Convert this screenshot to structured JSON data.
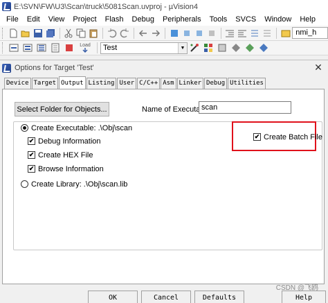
{
  "window": {
    "title": "E:\\SVN\\FW\\U3\\Scan\\truck\\5081Scan.uvproj - µVision4"
  },
  "menu": [
    "File",
    "Edit",
    "View",
    "Project",
    "Flash",
    "Debug",
    "Peripherals",
    "Tools",
    "SVCS",
    "Window",
    "Help"
  ],
  "toolbar": {
    "function_field": "nmi_h",
    "load_label": "Load",
    "target_select": "Test"
  },
  "dialog": {
    "title": "Options for Target 'Test'",
    "tabs": [
      "Device",
      "Target",
      "Output",
      "Listing",
      "User",
      "C/C++",
      "Asm",
      "Linker",
      "Debug",
      "Utilities"
    ],
    "active_tab": "Output",
    "select_folder_button": "Select Folder for Objects...",
    "name_of_executable_label": "Name of Executable:",
    "name_of_executable_value": "scan",
    "create_executable_label": "Create Executable:  .\\Obj\\scan",
    "options": [
      {
        "label": "Debug Information",
        "checked": true
      },
      {
        "label": "Create HEX File",
        "checked": true
      },
      {
        "label": "Browse Information",
        "checked": true
      }
    ],
    "create_batch_file": {
      "label": "Create Batch File",
      "checked": true
    },
    "create_library_label": "Create Library:  .\\Obj\\scan.lib",
    "buttons": {
      "ok": "OK",
      "cancel": "Cancel",
      "defaults": "Defaults",
      "help": "Help"
    }
  },
  "watermark": "CSDN @飞鸥",
  "colors": {
    "highlight_border": "#e0111b"
  }
}
